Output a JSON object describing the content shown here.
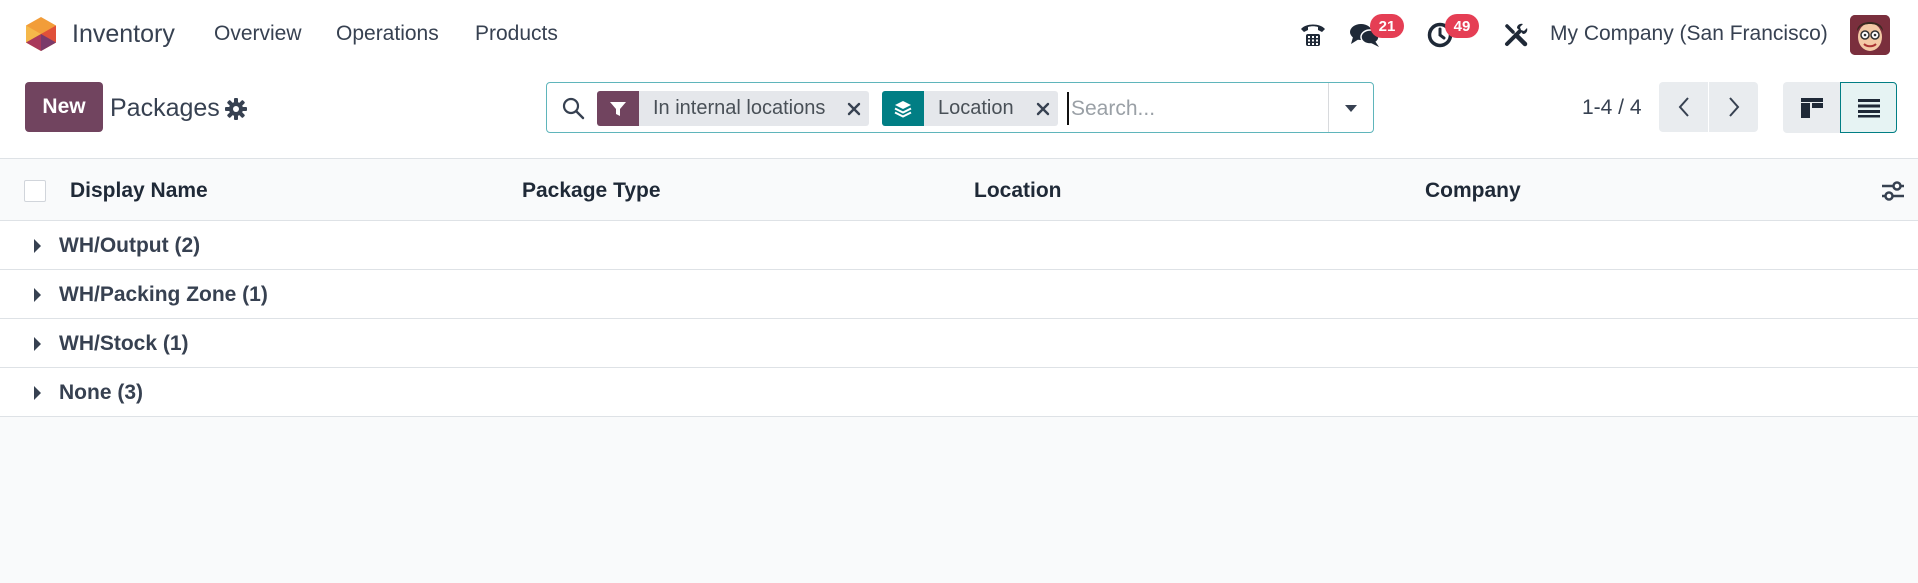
{
  "navbar": {
    "app_name": "Inventory",
    "menu": [
      "Overview",
      "Operations",
      "Products"
    ],
    "messages_count": "21",
    "activities_count": "49",
    "company": "My Company (San Francisco)"
  },
  "control_panel": {
    "new_label": "New",
    "breadcrumb": "Packages",
    "search": {
      "facets": [
        {
          "icon": "filter-icon",
          "label": "In internal locations",
          "color": "#71445f"
        },
        {
          "icon": "group-by-icon",
          "label": "Location",
          "color": "#017e84"
        }
      ],
      "placeholder": "Search..."
    },
    "pager": "1-4 / 4"
  },
  "list": {
    "columns": [
      "Display Name",
      "Package Type",
      "Location",
      "Company"
    ],
    "groups": [
      {
        "label": "WH/Output (2)"
      },
      {
        "label": "WH/Packing Zone (1)"
      },
      {
        "label": "WH/Stock (1)"
      },
      {
        "label": "None (3)"
      }
    ]
  },
  "colors": {
    "primary": "#71445f",
    "accent": "#017e84",
    "badge": "#e53e54"
  }
}
